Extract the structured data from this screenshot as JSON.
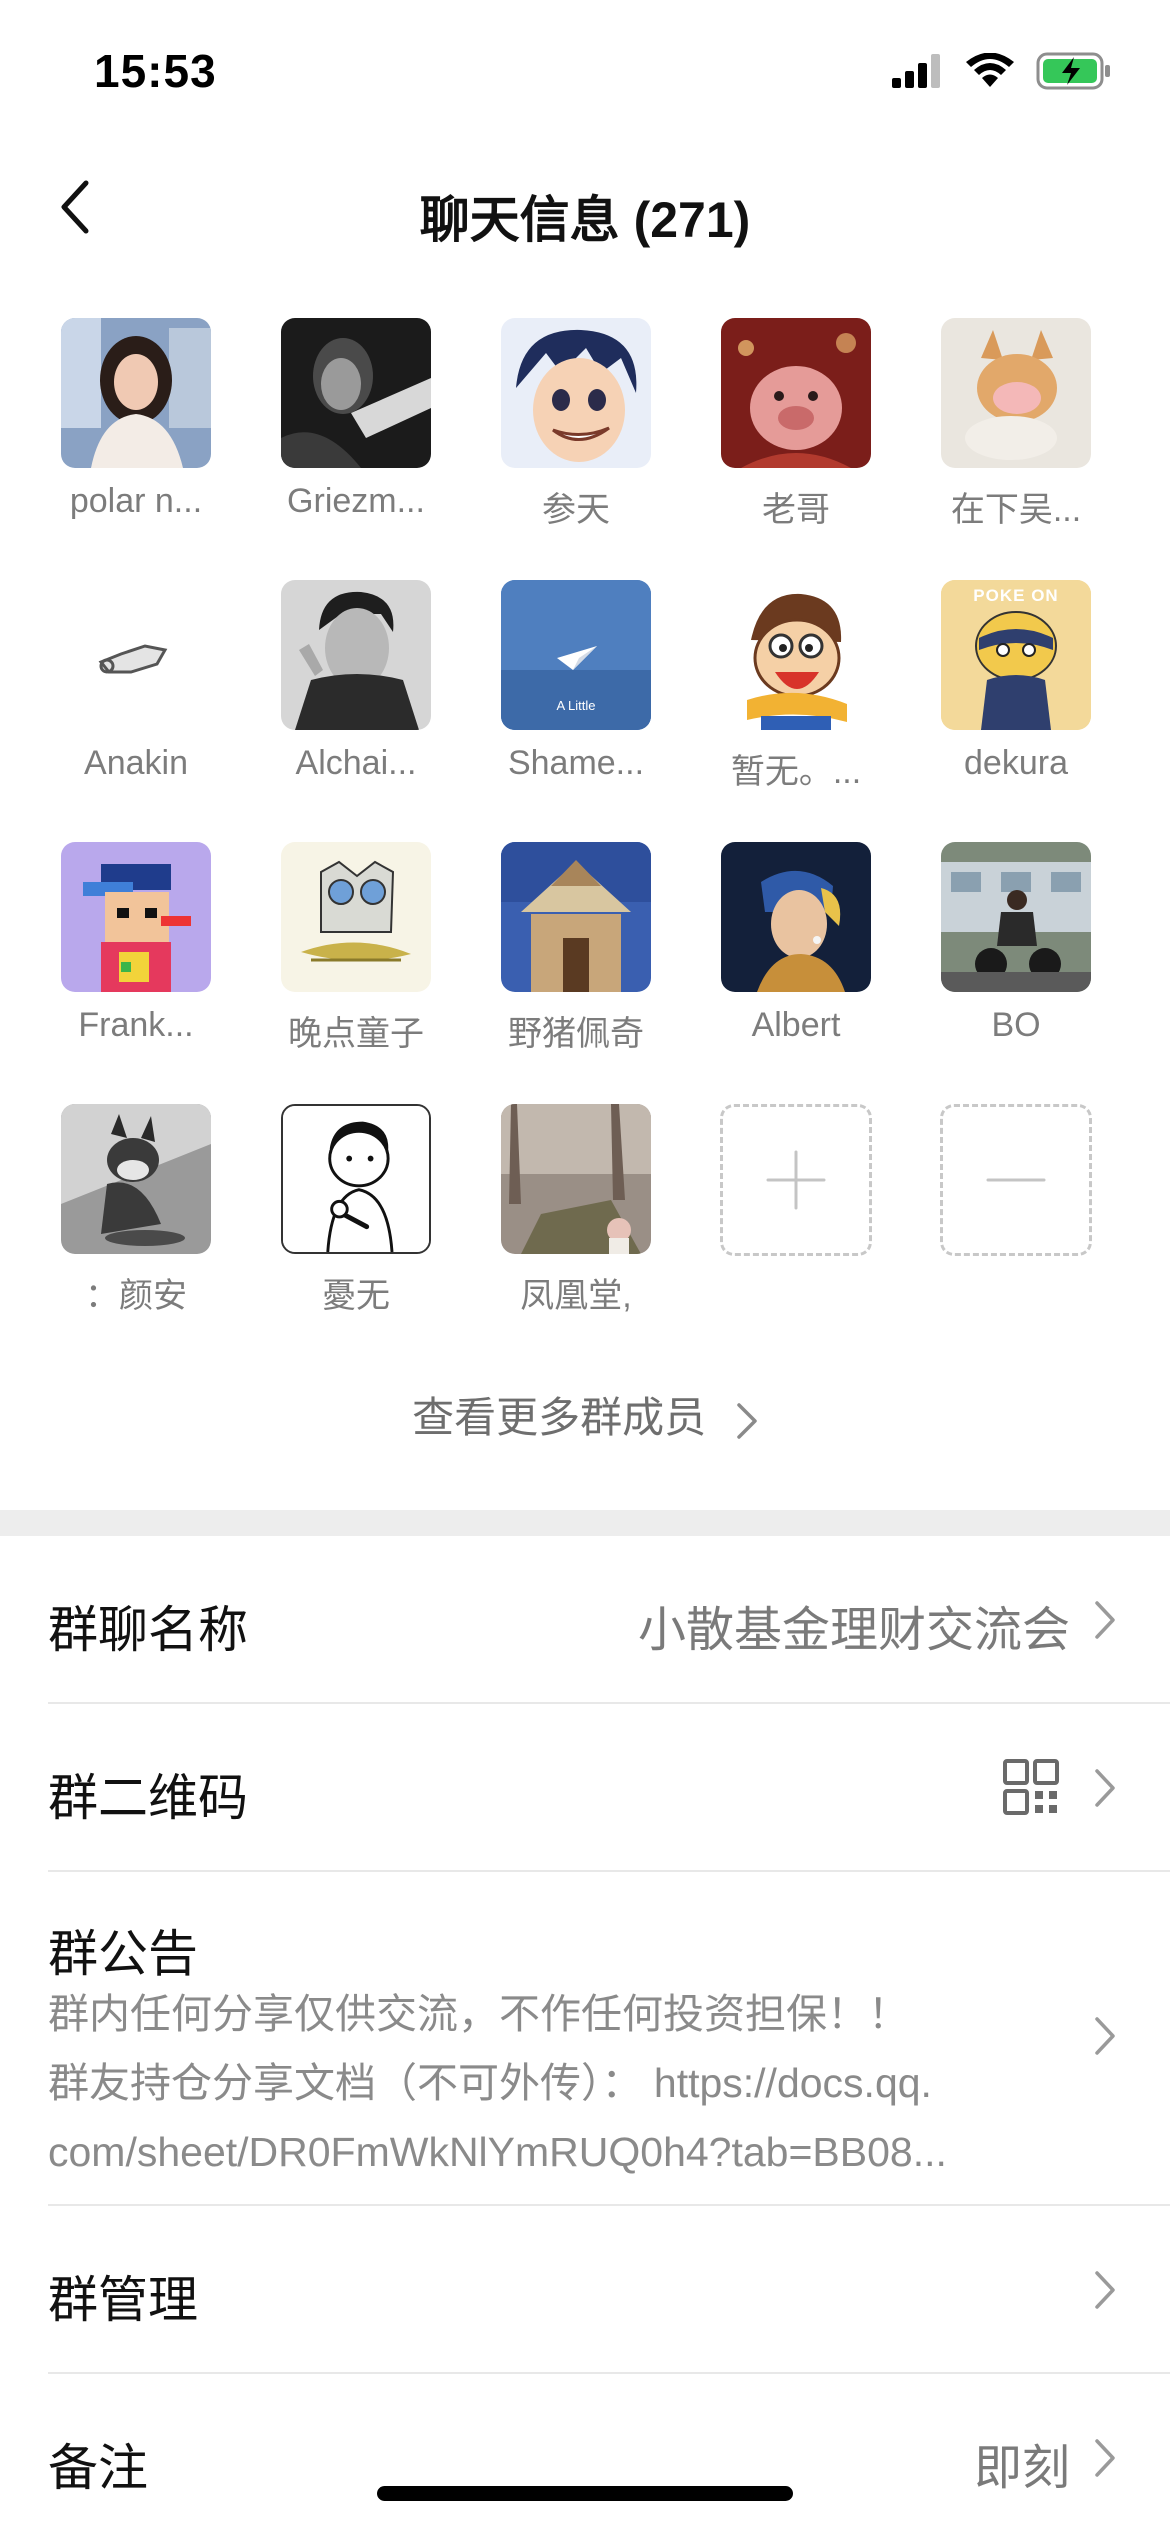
{
  "status_bar": {
    "time": "15:53"
  },
  "header": {
    "title": "聊天信息 (271)"
  },
  "members": [
    {
      "name": "polar n..."
    },
    {
      "name": "Griezm..."
    },
    {
      "name": "参天"
    },
    {
      "name": "老哥"
    },
    {
      "name": "在下吴..."
    },
    {
      "name": "Anakin"
    },
    {
      "name": "Alchai..."
    },
    {
      "name": "Shame..."
    },
    {
      "name": "暂无。..."
    },
    {
      "name": "dekura"
    },
    {
      "name": "Frank..."
    },
    {
      "name": "晚点童子"
    },
    {
      "name": "野猪佩奇"
    },
    {
      "name": "Albert"
    },
    {
      "name": "BO"
    },
    {
      "name": "：颜安"
    },
    {
      "name": "憂无"
    },
    {
      "name": "凤凰堂,"
    }
  ],
  "avatar_overlays": {
    "paper_plane_caption": "A Little",
    "poke_caption": "POKE ON"
  },
  "more_members_label": "查看更多群成员",
  "settings": {
    "group_name": {
      "label": "群聊名称",
      "value": "小散基金理财交流会"
    },
    "qr_code": {
      "label": "群二维码"
    },
    "notice": {
      "label": "群公告",
      "lines": [
        "群内任何分享仅供交流，不作任何投资担保！！",
        "群友持仓分享文档（不可外传）： https://docs.qq.",
        "com/sheet/DR0FmWkNlYmRUQ0h4?tab=BB08..."
      ]
    },
    "manage": {
      "label": "群管理"
    },
    "remark": {
      "label": "备注",
      "value": "即刻"
    }
  },
  "colors": {
    "battery": "#35c759",
    "divider": "#e8e8e8",
    "gap": "#ededed"
  }
}
